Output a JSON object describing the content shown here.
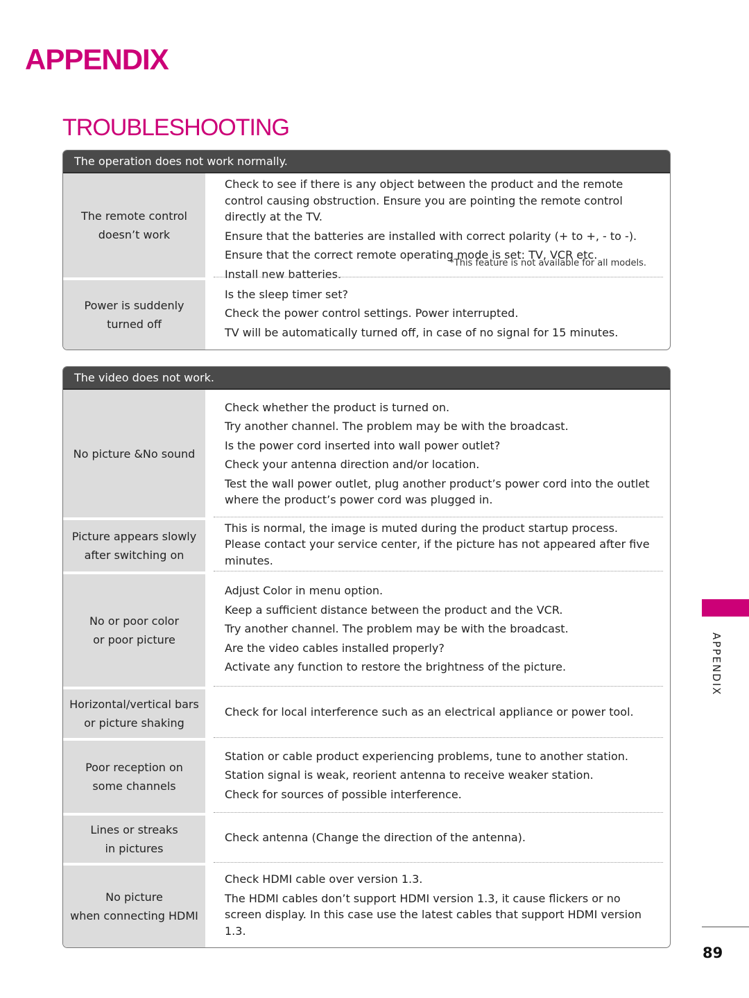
{
  "page": {
    "chapter_title": "APPENDIX",
    "section_title": "TROUBLESHOOTING",
    "side_tab_label": "APPENDIX",
    "page_number": "89",
    "accent_color": "#cc0077"
  },
  "panels": [
    {
      "header": "The operation does not work normally.",
      "rows": [
        {
          "problem": [
            "The remote control",
            "doesn’t work"
          ],
          "solutions": [
            "Check to see if there is any object between the product and the remote control causing obstruction. Ensure you are pointing the remote control directly at the TV.",
            "Ensure that the batteries are installed with correct polarity (+ to +, - to -).",
            "Ensure that the correct remote operating mode is set: TV, VCR etc.",
            "Install new batteries."
          ],
          "footnote": "*This feature is not available for all models."
        },
        {
          "problem": [
            "Power is suddenly",
            "turned off"
          ],
          "solutions": [
            "Is the sleep timer set?",
            "Check the power control settings. Power interrupted.",
            "TV will be automatically turned off, in case of no signal for 15 minutes."
          ]
        }
      ]
    },
    {
      "header": "The video does not work.",
      "rows": [
        {
          "problem": [
            "No picture &No sound"
          ],
          "solutions": [
            "Check whether the product is turned on.",
            "Try another channel. The problem may be with the broadcast.",
            "Is the power cord inserted into wall power outlet?",
            "Check your antenna direction and/or location.",
            "Test the wall power outlet, plug another product’s power cord into the outlet where the product’s power cord was plugged in."
          ]
        },
        {
          "problem": [
            "Picture appears slowly",
            "after switching on"
          ],
          "solutions": [
            "This is normal, the image is muted during the product startup process. Please contact your service center, if the picture has not appeared after five minutes."
          ]
        },
        {
          "problem": [
            "No or poor color",
            "or poor picture"
          ],
          "solutions": [
            "Adjust Color in menu option.",
            "Keep a sufficient distance between the product and the VCR.",
            "Try another channel. The problem may be with the broadcast.",
            "Are the video cables installed properly?",
            "Activate any function to restore the brightness of the picture."
          ]
        },
        {
          "problem": [
            "Horizontal/vertical bars",
            "or picture shaking"
          ],
          "solutions": [
            "Check for local interference such as an electrical appliance or power tool."
          ]
        },
        {
          "problem": [
            "Poor reception on",
            "some channels"
          ],
          "solutions": [
            "Station or cable product experiencing problems, tune to another station.",
            "Station signal is weak, reorient antenna to receive weaker station.",
            "Check for sources of possible interference."
          ]
        },
        {
          "problem": [
            "Lines or streaks",
            "in pictures"
          ],
          "solutions": [
            "Check antenna (Change the direction of the antenna)."
          ]
        },
        {
          "problem": [
            "No picture",
            "when connecting HDMI"
          ],
          "solutions": [
            "Check HDMI cable over version 1.3.",
            "The HDMI cables don’t support HDMI version 1.3, it cause flickers or no screen display. In this case use the latest cables that support HDMI version 1.3."
          ]
        }
      ]
    }
  ]
}
